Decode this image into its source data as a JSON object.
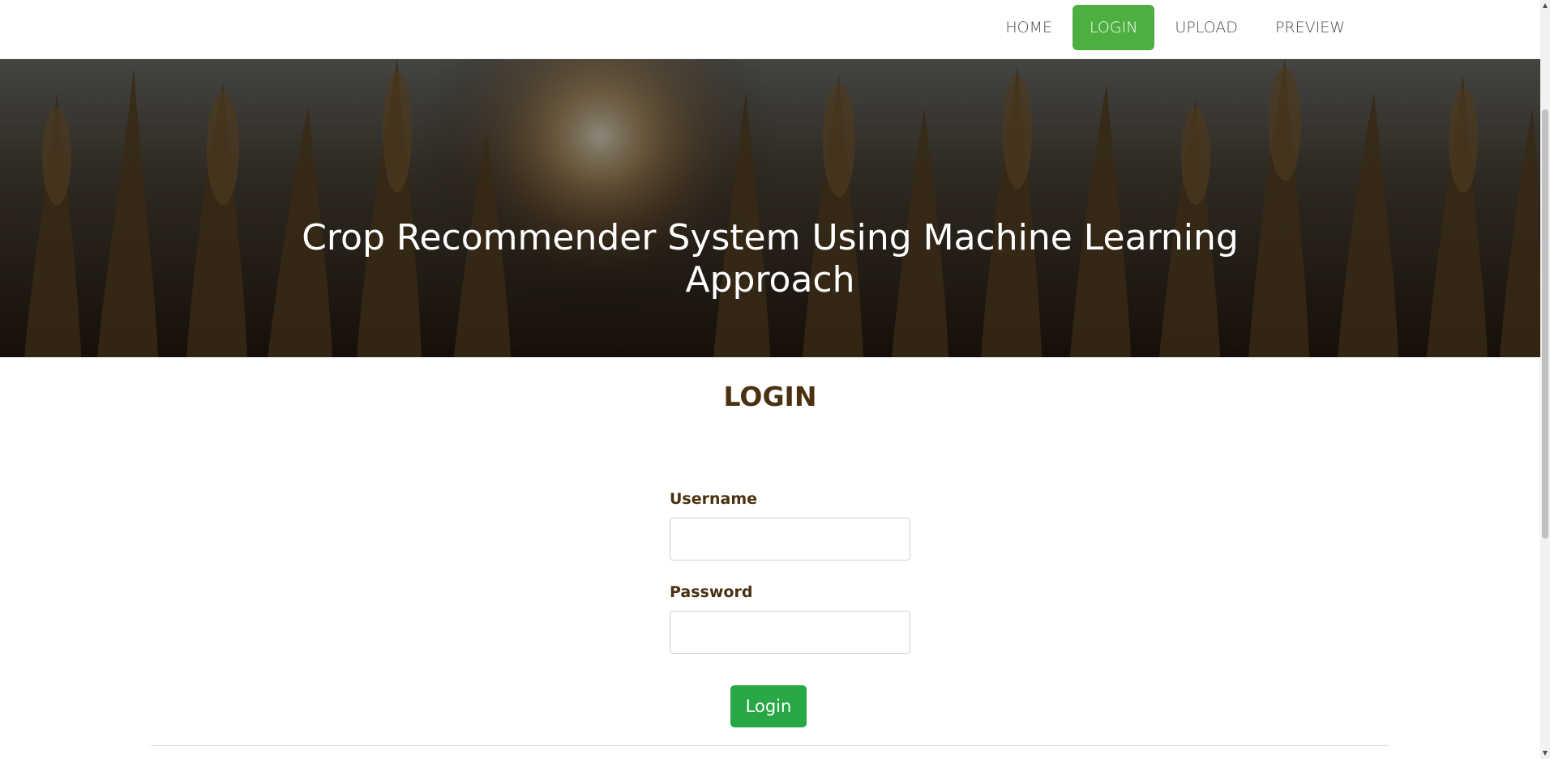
{
  "nav": {
    "items": [
      {
        "label": "HOME",
        "active": false
      },
      {
        "label": "LOGIN",
        "active": true
      },
      {
        "label": "UPLOAD",
        "active": false
      },
      {
        "label": "PREVIEW",
        "active": false
      }
    ]
  },
  "hero": {
    "title": "Crop Recommender System Using Machine Learning Approach"
  },
  "login": {
    "heading": "LOGIN",
    "username_label": "Username",
    "username_value": "",
    "password_label": "Password",
    "password_value": "",
    "submit_label": "Login"
  },
  "colors": {
    "accent": "#4caf3f",
    "button": "#28a745",
    "heading": "#4a3211"
  }
}
